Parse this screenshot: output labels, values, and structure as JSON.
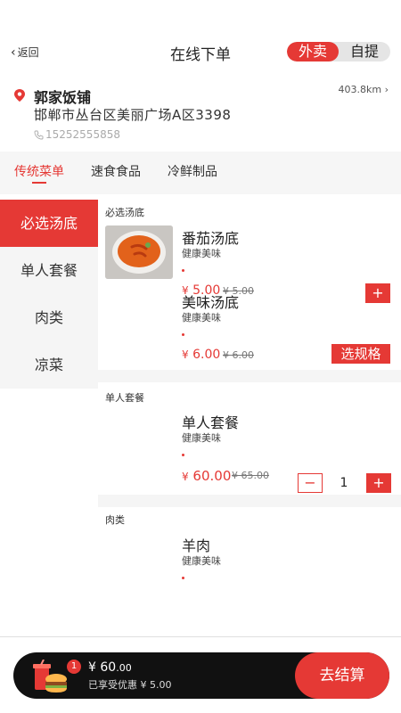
{
  "header": {
    "back_label": "返回",
    "title": "在线下单",
    "modes": [
      "外卖",
      "自提"
    ],
    "active_mode": "外卖"
  },
  "shop": {
    "name": "郭家饭铺",
    "distance": "403.8km",
    "address": "邯郸市丛台区美丽广场A区3398",
    "phone": "15252555858"
  },
  "tabs": [
    "传统菜单",
    "速食食品",
    "冷鲜制品"
  ],
  "sidebar": [
    "必选汤底",
    "单人套餐",
    "肉类",
    "凉菜"
  ],
  "sections": [
    {
      "title": "必选汤底",
      "items": [
        {
          "name": "番茄汤底",
          "desc": "健康美味",
          "currency": "¥",
          "price": "5.00",
          "orig": "¥ 5.00",
          "action": "+"
        },
        {
          "name": "美味汤底",
          "desc": "健康美味",
          "currency": "¥",
          "price": "6.00",
          "orig": "¥ 6.00",
          "action": "选规格"
        }
      ]
    },
    {
      "title": "单人套餐",
      "items": [
        {
          "name": "单人套餐",
          "desc": "健康美味",
          "currency": "¥",
          "price": "60.00",
          "orig": "¥ 65.00",
          "minus": "−",
          "qty": "1",
          "plus": "+"
        }
      ]
    },
    {
      "title": "肉类",
      "items": [
        {
          "name": "羊肉",
          "desc": "健康美味"
        }
      ]
    }
  ],
  "cart": {
    "badge": "1",
    "currency": "¥",
    "total_main": "60",
    "total_dec": ".00",
    "discount": "已享受优惠 ¥ 5.00",
    "checkout_label": "去结算"
  },
  "colors": {
    "accent": "#e53935",
    "cart_bar": "#111111"
  },
  "icons": {
    "back": "chevron-left-icon",
    "location": "location-pin-icon",
    "phone": "phone-icon",
    "cart": "cart-icon"
  }
}
